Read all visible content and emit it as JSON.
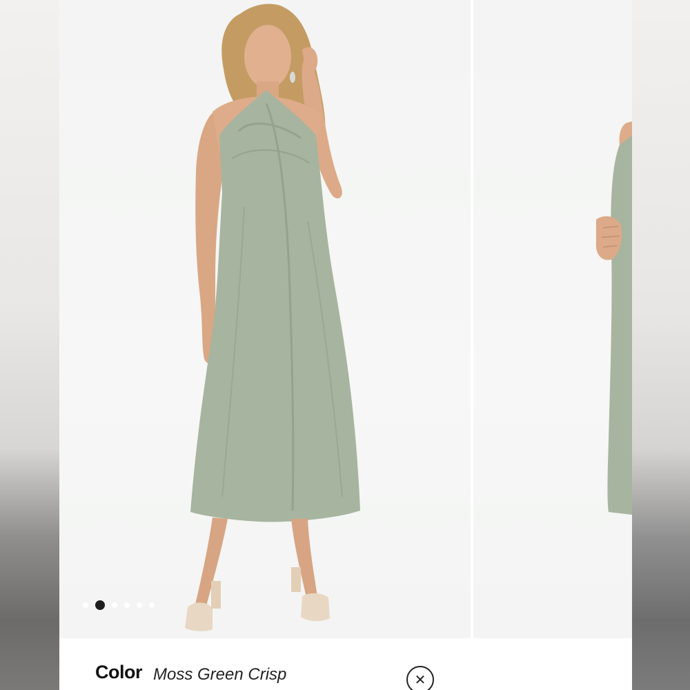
{
  "carousel": {
    "slide_count": 6,
    "active_index": 1,
    "images": [
      {
        "alt": "model-front-view"
      },
      {
        "alt": "model-side-view"
      }
    ]
  },
  "product": {
    "color_label": "Color",
    "color_value": "Moss Green Crisp"
  },
  "icons": {
    "close": "close-icon",
    "close_glyph": "✕"
  },
  "colors": {
    "dress": "#a7b49f",
    "background": "#f4f5f4",
    "text": "#111111",
    "active_dot": "#111111"
  }
}
